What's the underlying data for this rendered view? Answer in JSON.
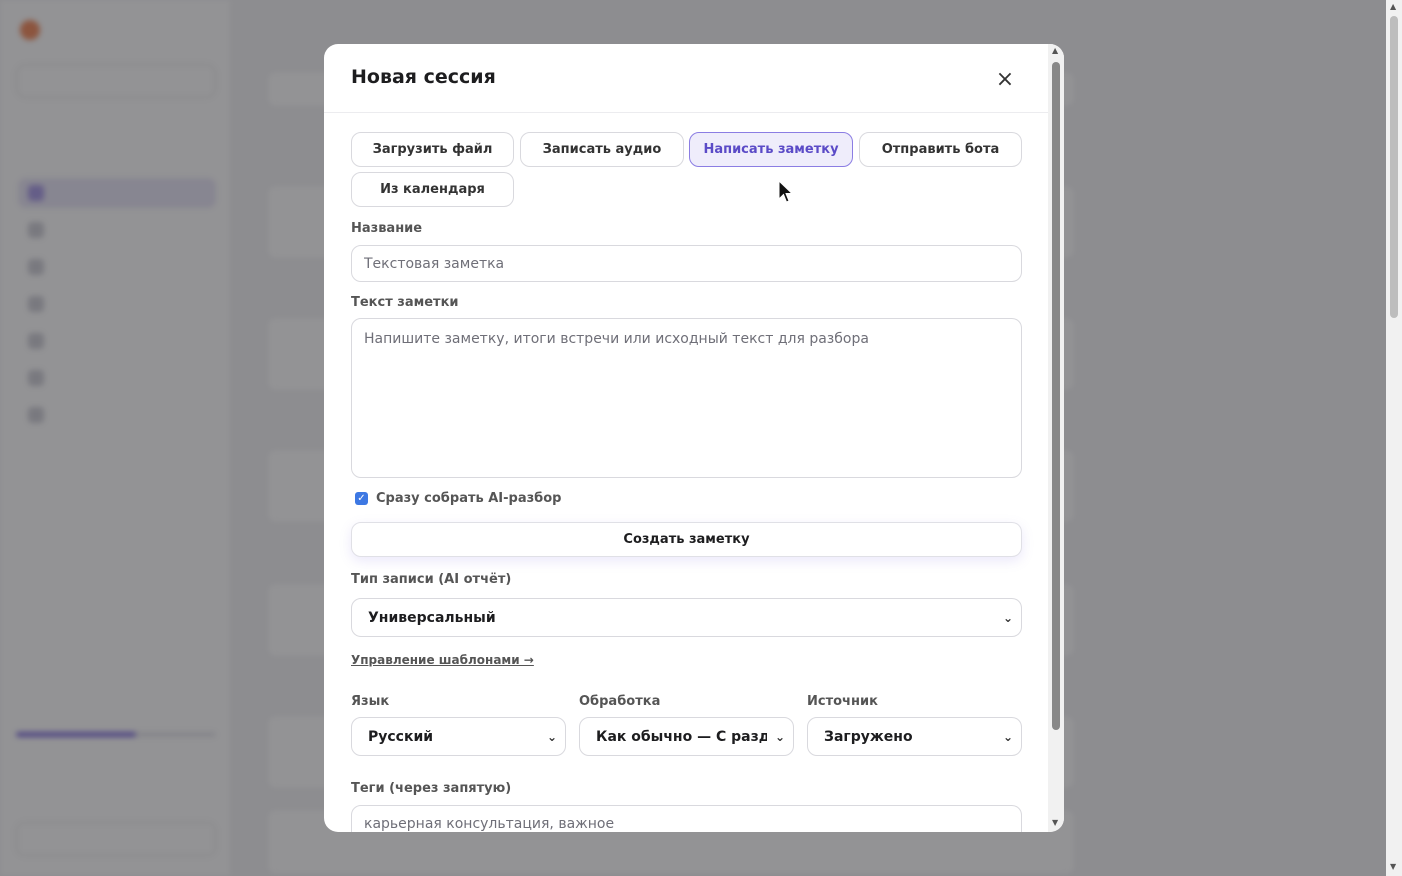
{
  "modal": {
    "title": "Новая сессия",
    "close_label": "×",
    "tabs": [
      {
        "label": "Загрузить файл"
      },
      {
        "label": "Записать аудио"
      },
      {
        "label": "Написать заметку",
        "active": true
      },
      {
        "label": "Отправить бота"
      },
      {
        "label": "Из календаря"
      }
    ],
    "name_label": "Название",
    "name_placeholder": "Текстовая заметка",
    "note_label": "Текст заметки",
    "note_placeholder": "Напишите заметку, итоги встречи или исходный текст для разбора",
    "ai_checkbox_label": "Сразу собрать AI-разбор",
    "ai_checkbox_checked": true,
    "create_button": "Создать заметку",
    "record_type_label": "Тип записи (AI отчёт)",
    "record_type_value": "Универсальный",
    "templates_link": "Управление шаблонами →",
    "language_label": "Язык",
    "language_value": "Русский",
    "processing_label": "Обработка",
    "processing_value": "Как обычно — С разделением",
    "source_label": "Источник",
    "source_value": "Загружено",
    "tags_label": "Теги (через запятую)",
    "tags_placeholder": "карьерная консультация, важное"
  },
  "icons": {
    "close": "close-icon",
    "chevron": "chevron-down-icon",
    "check": "check-icon"
  },
  "colors": {
    "accent": "#5b4bc7",
    "accent_bg": "#efedfb",
    "checkbox": "#3d78e3"
  }
}
